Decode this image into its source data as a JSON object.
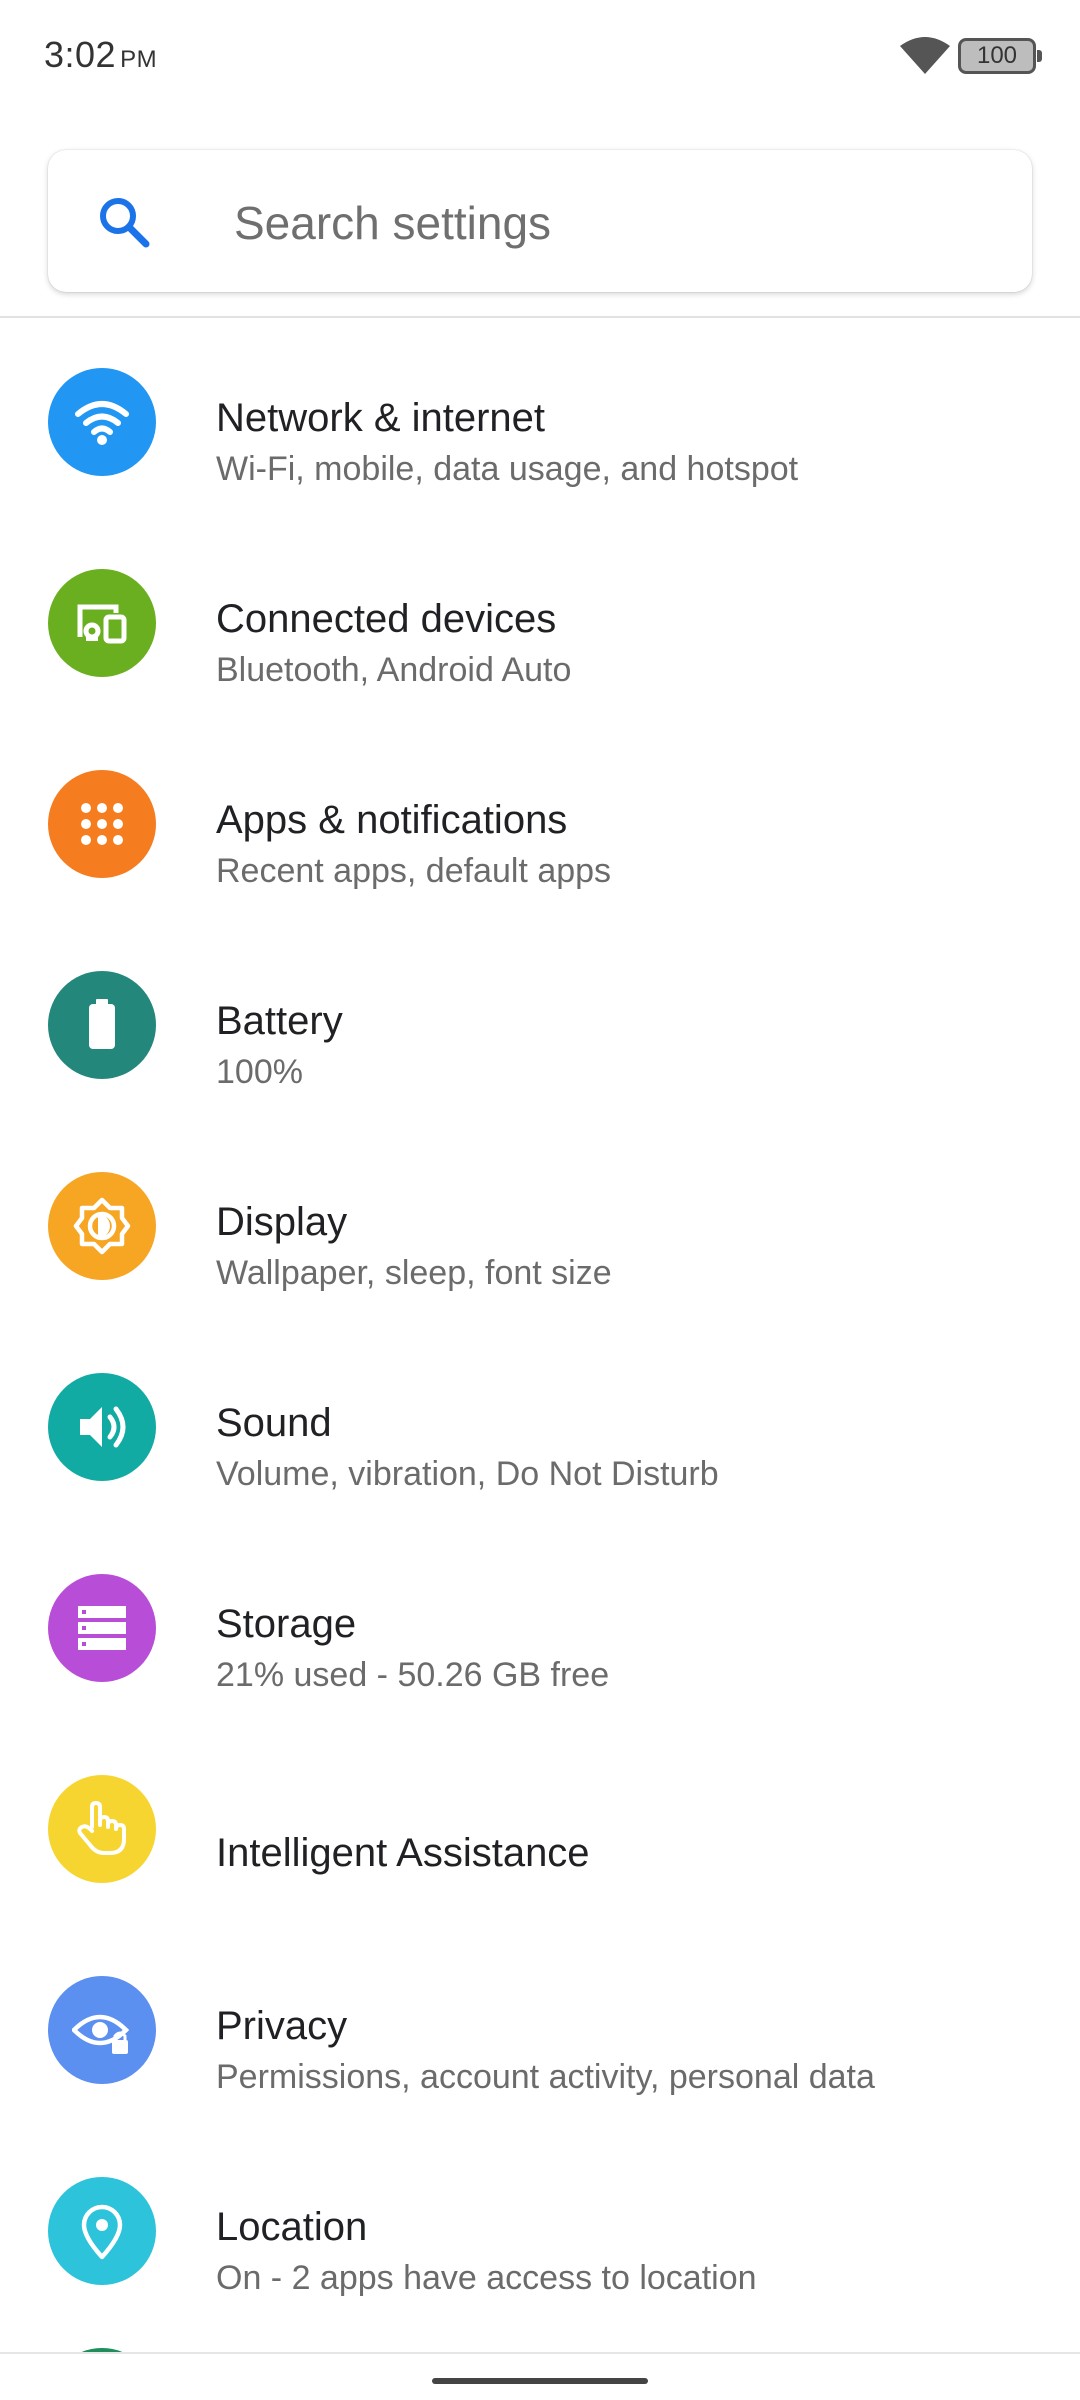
{
  "status_bar": {
    "time": "3:02",
    "ampm": "PM",
    "battery_level": "100"
  },
  "search": {
    "placeholder": "Search settings"
  },
  "settings": [
    {
      "title": "Network & internet",
      "subtitle": "Wi-Fi, mobile, data usage, and hotspot",
      "color": "#2196F3",
      "icon": "wifi-icon"
    },
    {
      "title": "Connected devices",
      "subtitle": "Bluetooth, Android Auto",
      "color": "#6AAF20",
      "icon": "connected-devices-icon"
    },
    {
      "title": "Apps & notifications",
      "subtitle": "Recent apps, default apps",
      "color": "#F57C1F",
      "icon": "apps-grid-icon"
    },
    {
      "title": "Battery",
      "subtitle": "100%",
      "color": "#23877B",
      "icon": "battery-icon"
    },
    {
      "title": "Display",
      "subtitle": "Wallpaper, sleep, font size",
      "color": "#F6A623",
      "icon": "brightness-icon"
    },
    {
      "title": "Sound",
      "subtitle": "Volume, vibration, Do Not Disturb",
      "color": "#12ABA4",
      "icon": "speaker-icon"
    },
    {
      "title": "Storage",
      "subtitle": "21% used - 50.26 GB free",
      "color": "#B84ED8",
      "icon": "storage-icon"
    },
    {
      "title": "Intelligent Assistance",
      "subtitle": "",
      "color": "#F7D531",
      "icon": "hand-pointer-icon"
    },
    {
      "title": "Privacy",
      "subtitle": "Permissions, account activity, personal data",
      "color": "#5B8FF0",
      "icon": "eye-lock-icon"
    },
    {
      "title": "Location",
      "subtitle": "On - 2 apps have access to location",
      "color": "#2CC3DB",
      "icon": "location-pin-icon"
    }
  ]
}
